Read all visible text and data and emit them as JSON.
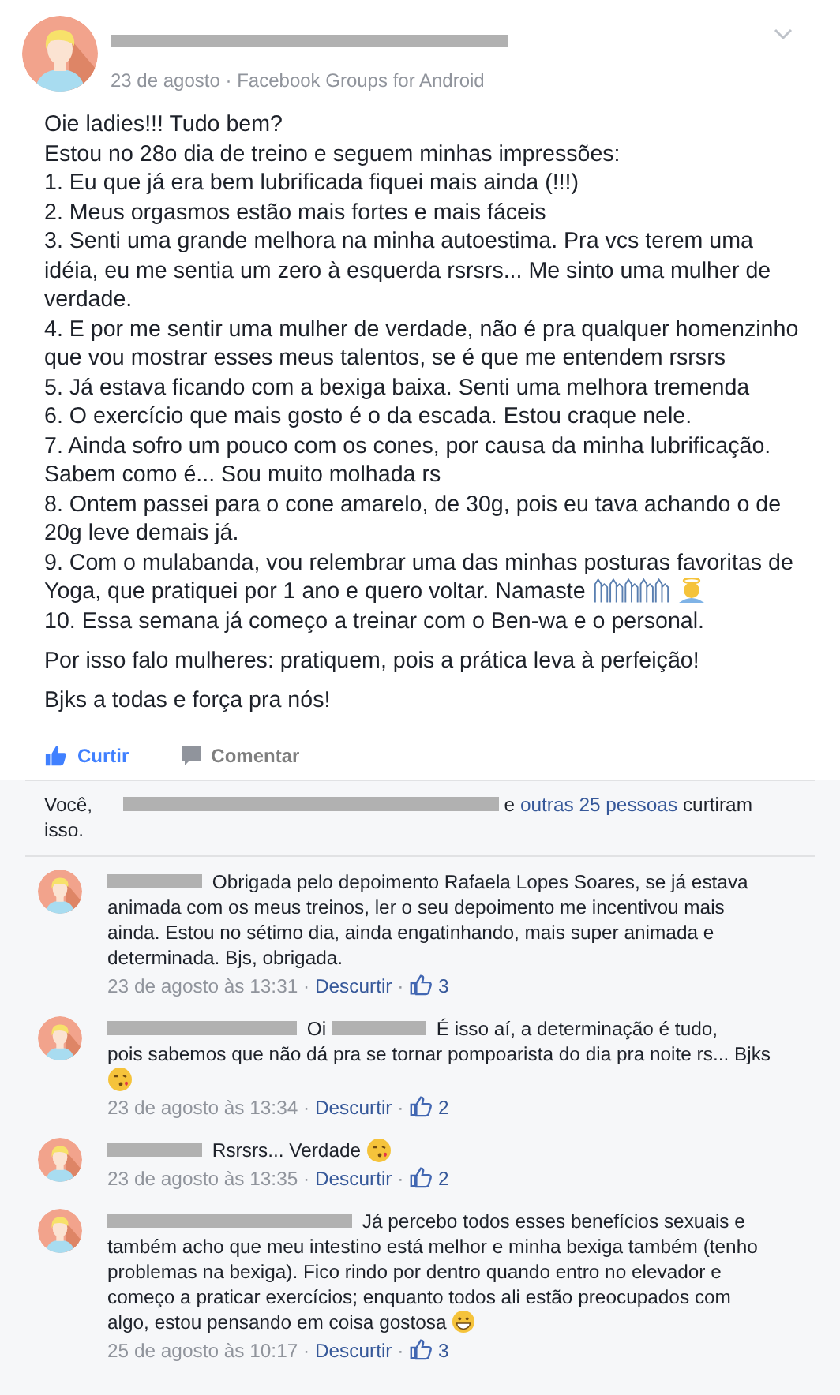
{
  "post": {
    "date": "23 de agosto",
    "separator": "·",
    "source": "Facebook Groups for Android",
    "body": [
      {
        "lines": [
          {
            "text": "Oie ladies!!! Tudo bem?"
          },
          {
            "text": "Estou no 28o dia de treino e seguem minhas impressões:"
          },
          {
            "text": "1. Eu que já era bem lubrificada fiquei mais ainda (!!!)"
          },
          {
            "text": "2. Meus orgasmos estão mais fortes e mais fáceis"
          },
          {
            "text": "3. Senti uma grande melhora na minha autoestima. Pra vcs terem uma"
          },
          {
            "text": "idéia, eu me sentia um zero à esquerda rsrsrs... Me sinto uma mulher de"
          },
          {
            "text": "verdade."
          },
          {
            "text": "4. E por me sentir uma mulher de verdade, não é pra qualquer homenzinho"
          },
          {
            "text": "que vou mostrar esses meus talentos, se é que me entendem rsrsrs"
          },
          {
            "text": "5. Já estava ficando com a bexiga baixa. Senti uma melhora tremenda"
          },
          {
            "text": "6. O exercício que mais gosto é o da escada. Estou craque nele."
          },
          {
            "text": "7. Ainda sofro um pouco com os cones, por causa da minha lubrificação."
          },
          {
            "text": "Sabem como é... Sou muito molhada rs"
          },
          {
            "text": "8. Ontem passei para o cone amarelo, de 30g, pois eu tava achando o de"
          },
          {
            "text": "20g leve demais já."
          },
          {
            "text": "9. Com o mulabanda, vou relembrar uma das minhas posturas favoritas de"
          },
          {
            "text": "Yoga, que pratiquei por 1 ano e quero voltar. Namaste",
            "emojis": [
              {
                "kind": "hands"
              },
              {
                "kind": "angel"
              }
            ]
          },
          {
            "text": "10. Essa semana já começo a treinar com o Ben-wa e o personal."
          }
        ]
      },
      {
        "lines": [
          {
            "text": "Por isso falo mulheres: pratiquem, pois a prática leva à perfeição!"
          }
        ]
      },
      {
        "lines": [
          {
            "text": "Bjks a todas e força pra nós!"
          }
        ]
      }
    ],
    "actions": [
      {
        "label": "Curtir",
        "kind": "like",
        "selected": true
      },
      {
        "label": "Comentar",
        "kind": "comment",
        "selected": false
      }
    ]
  },
  "likes": [
    [
      {
        "kind": "text",
        "text": "Você,"
      },
      {
        "kind": "fullbar"
      },
      {
        "kind": "text",
        "text": "e"
      },
      {
        "kind": "link",
        "text": "outras 25 pessoas"
      },
      {
        "kind": "text",
        "text": "curtiram"
      }
    ],
    [
      {
        "kind": "text",
        "text": "isso."
      }
    ]
  ],
  "comments": [
    {
      "lines": [
        [
          {
            "kind": "shortbar"
          },
          {
            "kind": "text",
            "text": "Obrigada pelo depoimento Rafaela Lopes Soares, se já estava"
          }
        ],
        [
          {
            "kind": "text",
            "text": "animada com os meus treinos, ler o seu depoimento me incentivou mais"
          }
        ],
        [
          {
            "kind": "text",
            "text": "ainda. Estou no sétimo dia, ainda engatinhando, mais super animada e"
          }
        ],
        [
          {
            "kind": "text",
            "text": "determinada. Bjs, obrigada."
          }
        ]
      ],
      "time": "23 de agosto às 13:31",
      "separator": "·",
      "action": "Descurtir",
      "likes": "3"
    },
    {
      "lines": [
        [
          {
            "kind": "longbar"
          },
          {
            "kind": "text",
            "text": "Oi"
          },
          {
            "kind": "shortbar"
          },
          {
            "kind": "text",
            "text": "É isso aí, a determinação é tudo,"
          }
        ],
        [
          {
            "kind": "text",
            "text": "pois sabemos que não dá pra se tornar pompoarista do dia pra noite rs... Bjks"
          }
        ],
        [
          {
            "kind": "kiss"
          }
        ]
      ],
      "time": "23 de agosto às 13:34",
      "separator": "·",
      "action": "Descurtir",
      "likes": "2"
    },
    {
      "lines": [
        [
          {
            "kind": "shortbar"
          },
          {
            "kind": "text",
            "text": "Rsrsrs... Verdade"
          },
          {
            "kind": "kiss"
          }
        ]
      ],
      "time": "23 de agosto às 13:35",
      "separator": "·",
      "action": "Descurtir",
      "likes": "2"
    },
    {
      "lines": [
        [
          {
            "kind": "widebar"
          },
          {
            "kind": "text",
            "text": "Já percebo todos esses benefícios sexuais e"
          }
        ],
        [
          {
            "kind": "text",
            "text": "também acho que meu intestino está melhor e minha bexiga também (tenho"
          }
        ],
        [
          {
            "kind": "text",
            "text": "problemas na bexiga). Fico rindo por dentro quando entro no elevador e"
          }
        ],
        [
          {
            "kind": "text",
            "text": "começo a praticar exercícios; enquanto todos ali estão preocupados com"
          }
        ],
        [
          {
            "kind": "text",
            "text": "algo, estou pensando em coisa gostosa"
          },
          {
            "kind": "grin"
          }
        ]
      ],
      "time": "25 de agosto às 10:17",
      "separator": "·",
      "action": "Descurtir",
      "likes": "3"
    }
  ]
}
